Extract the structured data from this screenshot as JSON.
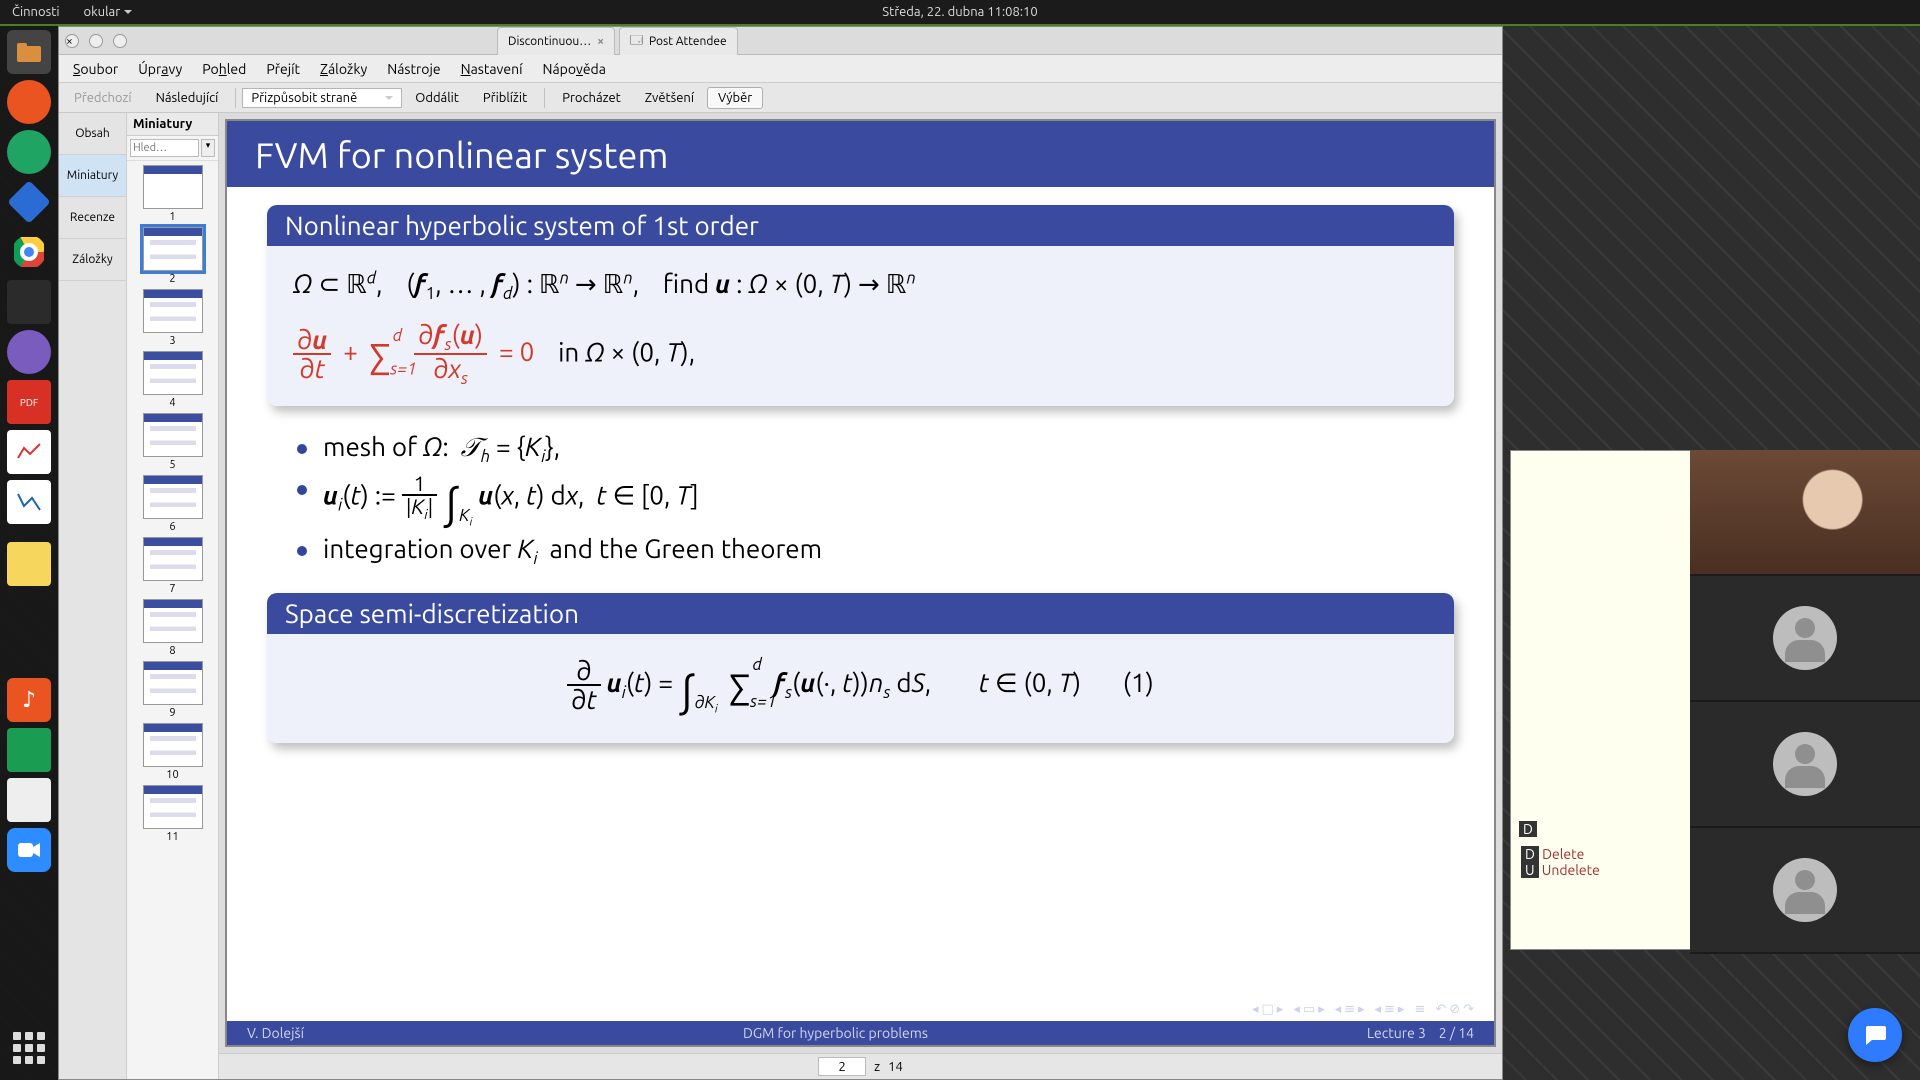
{
  "panel": {
    "activities": "Činnosti",
    "app": "okular",
    "clock": "Středa, 22. dubna  11:08:10"
  },
  "dock": {
    "items": [
      "files",
      "ubuntu",
      "calc",
      "tex",
      "chrome",
      "term",
      "emacs",
      "pdf",
      "gnuplot",
      "octave",
      "notes",
      "music",
      "sheets",
      "apps",
      "zoom"
    ]
  },
  "window": {
    "tabs": [
      {
        "label": "Discontinuou…",
        "close": "×"
      },
      {
        "label": "Post Attendee",
        "icon": "🗔"
      }
    ],
    "menus": [
      "Soubor",
      "Úpravy",
      "Pohled",
      "Přejít",
      "Záložky",
      "Nástroje",
      "Nastavení",
      "Nápověda"
    ],
    "toolbar": {
      "prev": "Předchozí",
      "next": "Následující",
      "fit": "Přizpůsobit straně",
      "zoomout": "Oddálit",
      "zoomin": "Přiblížit",
      "browse": "Procházet",
      "zoom": "Zvětšení",
      "select": "Výběr"
    },
    "side": {
      "contents": "Obsah",
      "thumbs": "Miniatury",
      "reviews": "Recenze",
      "bookmarks": "Záložky"
    },
    "thumbHeader": "Miniatury",
    "thumbSearch": "Hled…",
    "page": {
      "cur": "2",
      "sep": "z",
      "total": "14"
    }
  },
  "slide": {
    "title": "FVM for nonlinear system",
    "block1": "Nonlinear hyperbolic system of 1st order",
    "eq1a": "Ω ⊂ ℝ",
    "eq1b": ",    (𝒇₁, … , 𝒇_d) : ℝⁿ → ℝⁿ,    find 𝒖 : Ω × (0, T) → ℝⁿ",
    "bul1": "mesh of Ω:  𝒯_h = {K_i},",
    "bul3": "integration over K_i  and the Green theorem",
    "block2": "Space semi-discretization",
    "foot": {
      "author": "V. Dolejší",
      "mid": "DGM for hyperbolic problems",
      "lec": "Lecture 3",
      "pg": "2 / 14"
    }
  },
  "emacs": {
    "delete": "Delete",
    "undelete": "Undelete"
  },
  "chart_data": null
}
